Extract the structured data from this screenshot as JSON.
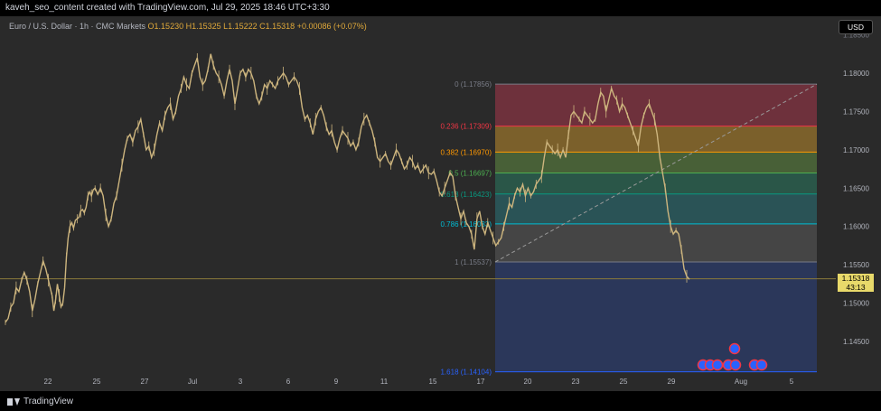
{
  "header": {
    "title": "kaveh_seo_content created with TradingView.com, Jul 29, 2025 18:46 UTC+3:30"
  },
  "legend": {
    "symbol": "Euro / U.S. Dollar · 1h · CMC Markets",
    "ohlc": "O1.15230 H1.15325 L1.15222 C1.15318 +0.00086 (+0.07%)"
  },
  "currency_button": "USD",
  "price_tag": {
    "price": "1.15318",
    "countdown": "43:13"
  },
  "footer": {
    "brand": "TradingView"
  },
  "colors": {
    "candles": "#cdb57e",
    "fib_0_0236": "#7a3340",
    "fib_0236_0382": "#8a6a2c",
    "fib_0382_05": "#4d6a3a",
    "fib_05_0618": "#2a5e4e",
    "fib_0618_0786": "#2a5a5e",
    "fib_0786_1": "#4a4a4a",
    "fib_1_1618": "#2c3a63",
    "last_price_line": "#8a7a3a"
  },
  "chart_data": {
    "type": "candlestick",
    "symbol": "EURUSD",
    "timeframe": "1h",
    "ylim": [
      1.141,
      1.186
    ],
    "y_ticks": [
      1.18,
      1.175,
      1.17,
      1.165,
      1.16,
      1.155,
      1.15,
      1.145
    ],
    "y_top_label": "1.18500",
    "x_ticks": [
      "22",
      "25",
      "27",
      "Jul",
      "3",
      "6",
      "9",
      "11",
      "15",
      "17",
      "20",
      "23",
      "25",
      "29",
      "Aug",
      "5"
    ],
    "series_path": [
      [
        0,
        1.1475
      ],
      [
        3,
        1.148
      ],
      [
        6,
        1.1495
      ],
      [
        9,
        1.15
      ],
      [
        12,
        1.152
      ],
      [
        15,
        1.1515
      ],
      [
        18,
        1.153
      ],
      [
        21,
        1.154
      ],
      [
        24,
        1.153
      ],
      [
        27,
        1.1515
      ],
      [
        30,
        1.149
      ],
      [
        33,
        1.1505
      ],
      [
        36,
        1.1525
      ],
      [
        39,
        1.154
      ],
      [
        42,
        1.1555
      ],
      [
        45,
        1.1545
      ],
      [
        48,
        1.153
      ],
      [
        50,
        1.152
      ],
      [
        52,
        1.151
      ],
      [
        54,
        1.149
      ],
      [
        56,
        1.1505
      ],
      [
        58,
        1.1525
      ],
      [
        60,
        1.151
      ],
      [
        62,
        1.1495
      ],
      [
        64,
        1.15
      ],
      [
        66,
        1.152
      ],
      [
        68,
        1.156
      ],
      [
        70,
        1.1585
      ],
      [
        72,
        1.16
      ],
      [
        74,
        1.1605
      ],
      [
        76,
        1.1598
      ],
      [
        78,
        1.1608
      ],
      [
        80,
        1.161
      ],
      [
        82,
        1.1612
      ],
      [
        84,
        1.162
      ],
      [
        86,
        1.1622
      ],
      [
        88,
        1.1618
      ],
      [
        90,
        1.1625
      ],
      [
        92,
        1.164
      ],
      [
        94,
        1.1645
      ],
      [
        96,
        1.164
      ],
      [
        98,
        1.1648
      ],
      [
        100,
        1.165
      ],
      [
        103,
        1.1642
      ],
      [
        106,
        1.165
      ],
      [
        109,
        1.164
      ],
      [
        112,
        1.1615
      ],
      [
        115,
        1.16
      ],
      [
        118,
        1.161
      ],
      [
        121,
        1.163
      ],
      [
        124,
        1.164
      ],
      [
        127,
        1.166
      ],
      [
        130,
        1.168
      ],
      [
        133,
        1.17
      ],
      [
        136,
        1.1715
      ],
      [
        139,
        1.172
      ],
      [
        142,
        1.171
      ],
      [
        145,
        1.1725
      ],
      [
        148,
        1.173
      ],
      [
        151,
        1.174
      ],
      [
        154,
        1.172
      ],
      [
        157,
        1.17
      ],
      [
        160,
        1.1705
      ],
      [
        163,
        1.169
      ],
      [
        166,
        1.17
      ],
      [
        169,
        1.172
      ],
      [
        172,
        1.1735
      ],
      [
        175,
        1.1725
      ],
      [
        178,
        1.1745
      ],
      [
        181,
        1.1755
      ],
      [
        184,
        1.176
      ],
      [
        187,
        1.174
      ],
      [
        190,
        1.175
      ],
      [
        193,
        1.177
      ],
      [
        196,
        1.178
      ],
      [
        199,
        1.1795
      ],
      [
        202,
        1.1785
      ],
      [
        205,
        1.178
      ],
      [
        208,
        1.18
      ],
      [
        211,
        1.181
      ],
      [
        214,
        1.182
      ],
      [
        217,
        1.1795
      ],
      [
        220,
        1.1785
      ],
      [
        223,
        1.179
      ],
      [
        226,
        1.1805
      ],
      [
        229,
        1.1825
      ],
      [
        232,
        1.181
      ],
      [
        235,
        1.18
      ],
      [
        238,
        1.1795
      ],
      [
        241,
        1.1785
      ],
      [
        244,
        1.177
      ],
      [
        247,
        1.179
      ],
      [
        250,
        1.1805
      ],
      [
        253,
        1.179
      ],
      [
        256,
        1.176
      ],
      [
        259,
        1.178
      ],
      [
        262,
        1.18
      ],
      [
        265,
        1.1805
      ],
      [
        268,
        1.1795
      ],
      [
        271,
        1.1805
      ],
      [
        274,
        1.18
      ],
      [
        277,
        1.179
      ],
      [
        280,
        1.177
      ],
      [
        283,
        1.176
      ],
      [
        286,
        1.177
      ],
      [
        289,
        1.1785
      ],
      [
        292,
        1.178
      ],
      [
        295,
        1.179
      ],
      [
        298,
        1.1785
      ],
      [
        301,
        1.178
      ],
      [
        304,
        1.179
      ],
      [
        307,
        1.1795
      ],
      [
        310,
        1.18
      ],
      [
        313,
        1.1795
      ],
      [
        316,
        1.1785
      ],
      [
        319,
        1.179
      ],
      [
        322,
        1.1795
      ],
      [
        325,
        1.179
      ],
      [
        328,
        1.178
      ],
      [
        331,
        1.1755
      ],
      [
        334,
        1.174
      ],
      [
        337,
        1.1745
      ],
      [
        340,
        1.1735
      ],
      [
        343,
        1.172
      ],
      [
        346,
        1.174
      ],
      [
        349,
        1.175
      ],
      [
        352,
        1.1755
      ],
      [
        355,
        1.1745
      ],
      [
        358,
        1.173
      ],
      [
        361,
        1.172
      ],
      [
        364,
        1.1725
      ],
      [
        367,
        1.171
      ],
      [
        370,
        1.17
      ],
      [
        373,
        1.1715
      ],
      [
        376,
        1.1725
      ],
      [
        379,
        1.172
      ],
      [
        382,
        1.1715
      ],
      [
        385,
        1.1705
      ],
      [
        388,
        1.171
      ],
      [
        391,
        1.17
      ],
      [
        394,
        1.171
      ],
      [
        397,
        1.173
      ],
      [
        400,
        1.174
      ],
      [
        403,
        1.1745
      ],
      [
        406,
        1.1735
      ],
      [
        409,
        1.1725
      ],
      [
        412,
        1.171
      ],
      [
        415,
        1.169
      ],
      [
        418,
        1.1685
      ],
      [
        421,
        1.169
      ],
      [
        424,
        1.1695
      ],
      [
        427,
        1.1685
      ],
      [
        430,
        1.168
      ],
      [
        433,
        1.169
      ],
      [
        436,
        1.17
      ],
      [
        439,
        1.1695
      ],
      [
        442,
        1.1685
      ],
      [
        445,
        1.1675
      ],
      [
        448,
        1.168
      ],
      [
        451,
        1.169
      ],
      [
        454,
        1.1685
      ],
      [
        457,
        1.1675
      ],
      [
        460,
        1.168
      ],
      [
        463,
        1.167
      ],
      [
        466,
        1.1675
      ],
      [
        469,
        1.168
      ],
      [
        472,
        1.167
      ],
      [
        475,
        1.1668
      ],
      [
        478,
        1.1672
      ],
      [
        481,
        1.166
      ],
      [
        484,
        1.1645
      ],
      [
        487,
        1.164
      ],
      [
        490,
        1.165
      ],
      [
        493,
        1.166
      ],
      [
        496,
        1.167
      ],
      [
        499,
        1.1665
      ],
      [
        502,
        1.164
      ],
      [
        505,
        1.1625
      ],
      [
        508,
        1.161
      ],
      [
        511,
        1.162
      ],
      [
        514,
        1.1605
      ],
      [
        517,
        1.16
      ],
      [
        520,
        1.159
      ],
      [
        523,
        1.157
      ],
      [
        526,
        1.161
      ],
      [
        529,
        1.162
      ],
      [
        532,
        1.16
      ],
      [
        535,
        1.159
      ],
      [
        538,
        1.1605
      ],
      [
        541,
        1.1595
      ],
      [
        544,
        1.1585
      ],
      [
        547,
        1.1575
      ],
      [
        550,
        1.158
      ],
      [
        553,
        1.1585
      ],
      [
        556,
        1.16
      ],
      [
        559,
        1.1615
      ],
      [
        562,
        1.163
      ],
      [
        565,
        1.1625
      ],
      [
        568,
        1.164
      ],
      [
        571,
        1.165
      ],
      [
        574,
        1.1645
      ],
      [
        577,
        1.1655
      ],
      [
        580,
        1.164
      ],
      [
        583,
        1.165
      ],
      [
        586,
        1.164
      ],
      [
        589,
        1.1645
      ],
      [
        592,
        1.1655
      ],
      [
        595,
        1.166
      ],
      [
        598,
        1.1665
      ],
      [
        601,
        1.169
      ],
      [
        604,
        1.171
      ],
      [
        607,
        1.1705
      ],
      [
        610,
        1.17
      ],
      [
        613,
        1.1695
      ],
      [
        616,
        1.17
      ],
      [
        619,
        1.169
      ],
      [
        622,
        1.17
      ],
      [
        625,
        1.169
      ],
      [
        628,
        1.172
      ],
      [
        631,
        1.1745
      ],
      [
        634,
        1.175
      ],
      [
        637,
        1.1745
      ],
      [
        640,
        1.174
      ],
      [
        643,
        1.1735
      ],
      [
        646,
        1.175
      ],
      [
        649,
        1.1745
      ],
      [
        652,
        1.174
      ],
      [
        655,
        1.1735
      ],
      [
        658,
        1.174
      ],
      [
        661,
        1.176
      ],
      [
        664,
        1.1775
      ],
      [
        667,
        1.177
      ],
      [
        670,
        1.175
      ],
      [
        673,
        1.1765
      ],
      [
        676,
        1.178
      ],
      [
        679,
        1.177
      ],
      [
        682,
        1.1765
      ],
      [
        685,
        1.175
      ],
      [
        688,
        1.176
      ],
      [
        691,
        1.1755
      ],
      [
        694,
        1.1745
      ],
      [
        697,
        1.1735
      ],
      [
        700,
        1.1725
      ],
      [
        703,
        1.1715
      ],
      [
        706,
        1.1705
      ],
      [
        709,
        1.173
      ],
      [
        712,
        1.1745
      ],
      [
        715,
        1.1755
      ],
      [
        718,
        1.176
      ],
      [
        721,
        1.175
      ],
      [
        724,
        1.174
      ],
      [
        727,
        1.172
      ],
      [
        730,
        1.169
      ],
      [
        733,
        1.167
      ],
      [
        736,
        1.165
      ],
      [
        739,
        1.162
      ],
      [
        742,
        1.16
      ],
      [
        745,
        1.159
      ],
      [
        748,
        1.1595
      ],
      [
        751,
        1.159
      ],
      [
        754,
        1.157
      ],
      [
        757,
        1.1545
      ],
      [
        760,
        1.1535
      ],
      [
        763,
        1.1531
      ]
    ],
    "fibonacci": [
      {
        "ratio": "0",
        "price": 1.17856,
        "label": "0 (1.17856)",
        "color": "#787b86"
      },
      {
        "ratio": "0.236",
        "price": 1.17309,
        "label": "0.236 (1.17309)",
        "color": "#f23645"
      },
      {
        "ratio": "0.382",
        "price": 1.1697,
        "label": "0.382 (1.16970)",
        "color": "#ff9800"
      },
      {
        "ratio": "0.5",
        "price": 1.16697,
        "label": "0.5 (1.16697)",
        "color": "#4caf50"
      },
      {
        "ratio": "0.618",
        "price": 1.16423,
        "label": "0.618 (1.16423)",
        "color": "#089981"
      },
      {
        "ratio": "0.786",
        "price": 1.16033,
        "label": "0.786 (1.16033)",
        "color": "#00bcd4"
      },
      {
        "ratio": "1",
        "price": 1.15537,
        "label": "1 (1.15537)",
        "color": "#787b86"
      },
      {
        "ratio": "1.618",
        "price": 1.14104,
        "label": "1.618 (1.14104)",
        "color": "#2962ff"
      }
    ],
    "fib_trendline": {
      "from": 1.15537,
      "to": 1.17856
    },
    "last_price": 1.15318,
    "event_markers": [
      "upper",
      "lower1",
      "lower2",
      "lower3",
      "lower4",
      "lower5",
      "lower6",
      "lower7"
    ]
  }
}
